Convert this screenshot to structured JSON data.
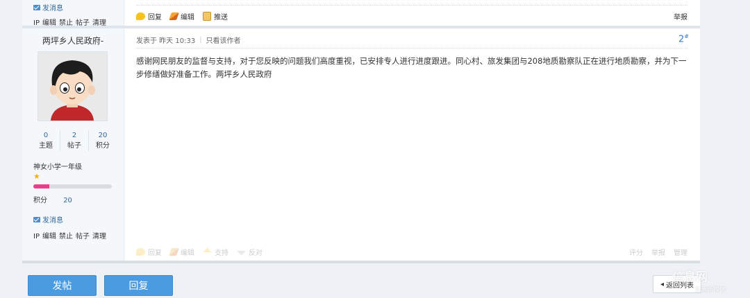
{
  "user": {
    "send_message": "发消息",
    "admin_links": [
      "IP",
      "编辑",
      "禁止",
      "帖子",
      "清理"
    ],
    "name": "两坪乡人民政府-",
    "stats": [
      {
        "value": "0",
        "label": "主题"
      },
      {
        "value": "2",
        "label": "帖子"
      },
      {
        "value": "20",
        "label": "积分"
      }
    ],
    "rank": "神女小学一年级",
    "level_progress": 0.2,
    "points_label": "积分",
    "points_value": "20",
    "send_message_2": "发消息",
    "admin_links_2": [
      "IP",
      "编辑",
      "禁止",
      "帖子",
      "清理"
    ]
  },
  "prev_post_toolbar": {
    "reply": "回复",
    "edit": "编辑",
    "push": "推送",
    "report": "举报"
  },
  "post": {
    "posted_at": "发表于 昨天 10:33",
    "only_author": "只看该作者",
    "floor": "2",
    "floor_mark": "#",
    "body": "感谢网民朋友的监督与支持，对于您反映的问题我们高度重视，已安排专人进行进度跟进。同心村、旅发集团与208地质勘察队正在进行地质勘察，并为下一步修缮做好准备工作。两坪乡人民政府",
    "toolbar": {
      "reply": "回复",
      "edit": "编辑",
      "support": "支持",
      "oppose": "反对",
      "rate": "评分",
      "report": "举报",
      "manage": "管理"
    }
  },
  "actions": {
    "new_post": "发帖",
    "reply": "回复",
    "back_to_list": "返回列表"
  },
  "watermark": {
    "main": "信息网",
    "sub": "生活新媒体"
  },
  "colors": {
    "accent": "#4a9be0",
    "link": "#336699",
    "floor": "#3a7bd5",
    "level_fill": "#e83e8c"
  }
}
